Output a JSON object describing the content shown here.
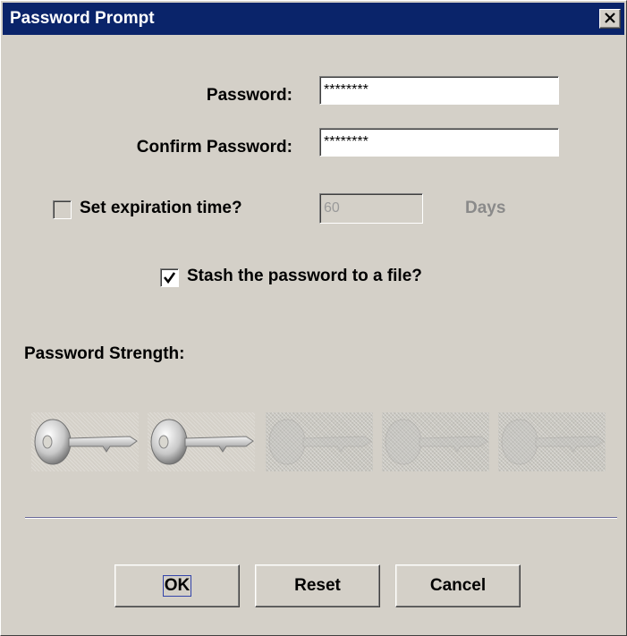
{
  "window": {
    "title": "Password Prompt"
  },
  "form": {
    "password_label": "Password:",
    "password_value": "********",
    "confirm_label": "Confirm Password:",
    "confirm_value": "********",
    "expiration_label": "Set expiration time?",
    "expiration_checked": false,
    "expiration_value": "60",
    "expiration_unit": "Days",
    "stash_label": "Stash the password to a file?",
    "stash_checked": true
  },
  "strength": {
    "label": "Password Strength:",
    "level": 2,
    "max": 5
  },
  "buttons": {
    "ok": "OK",
    "reset": "Reset",
    "cancel": "Cancel"
  },
  "icons": [
    "close-icon",
    "checkmark-icon",
    "key-icon"
  ]
}
